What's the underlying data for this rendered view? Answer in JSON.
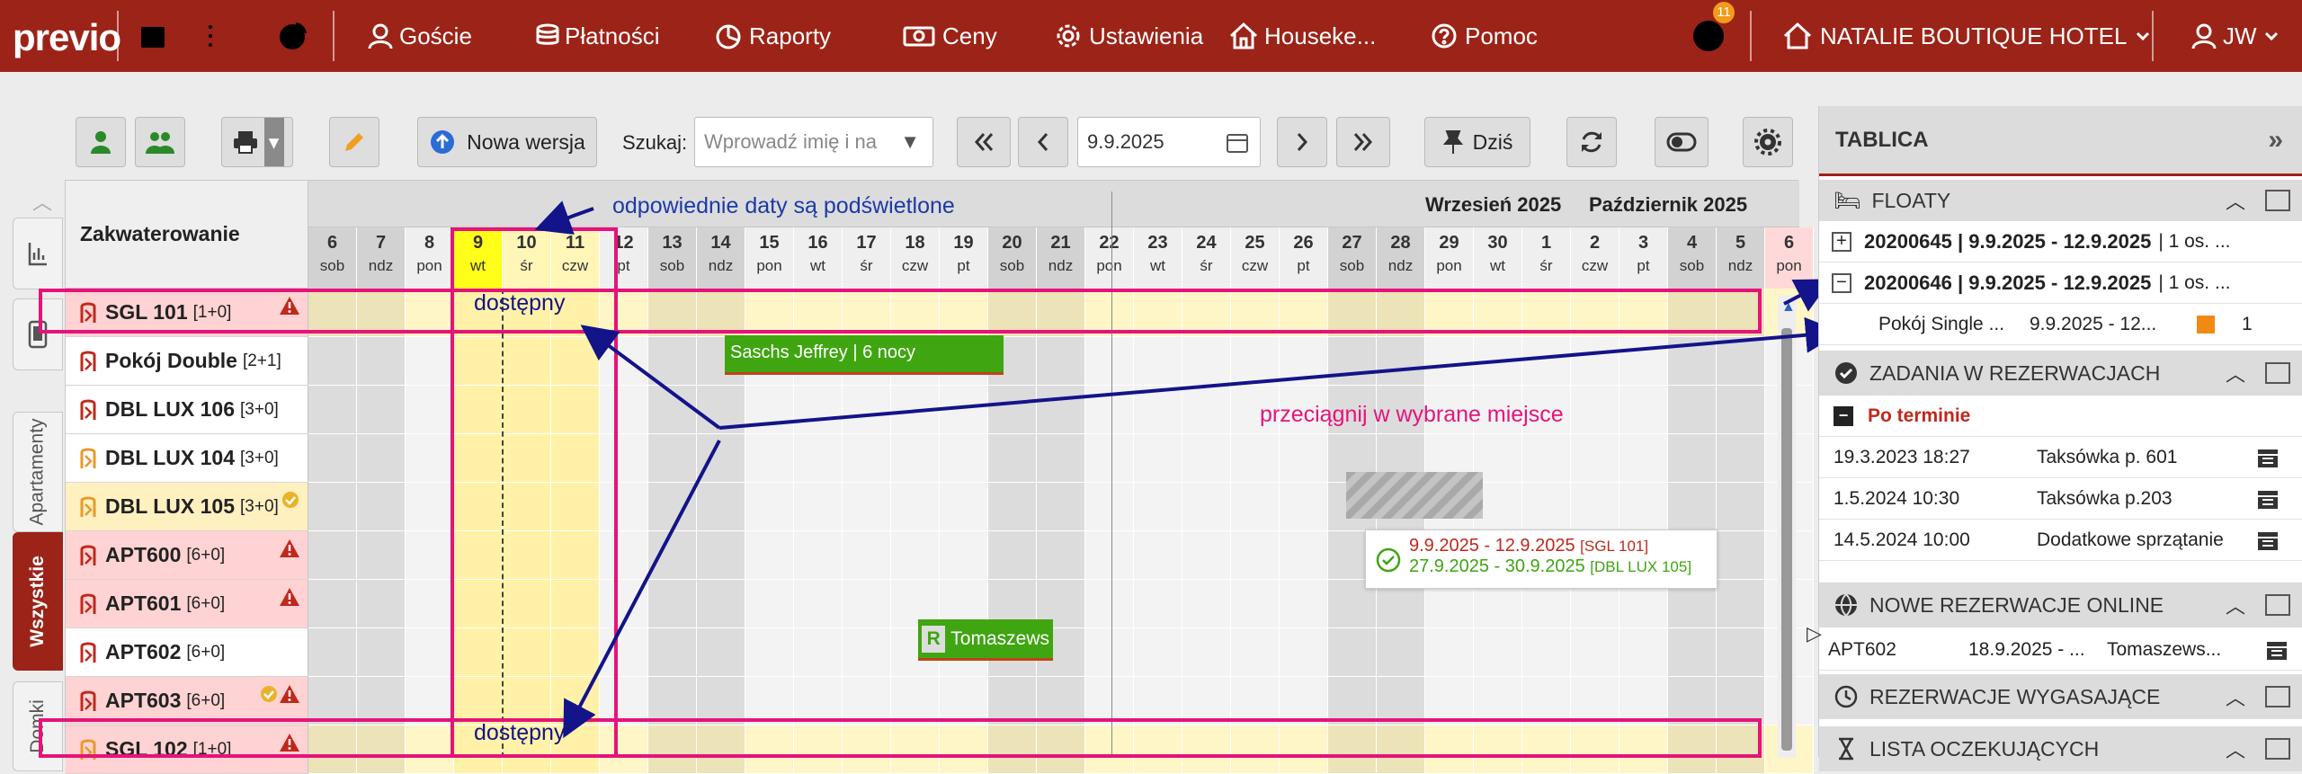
{
  "nav": {
    "logo": "previo",
    "guests": "Goście",
    "payments": "Płatności",
    "reports": "Raporty",
    "prices": "Ceny",
    "settings": "Ustawienia",
    "housekeeping": "Houseke...",
    "help": "Pomoc",
    "tasks_count": "11",
    "hotel": "NATALIE BOUTIQUE HOTEL",
    "user": "JW"
  },
  "toolbar": {
    "new_version": "Nowa wersja",
    "search_label": "Szukaj:",
    "search_placeholder": "Wprowadź imię i na",
    "date_value": "9.9.2025",
    "today": "Dziś"
  },
  "sidebar_tabs": [
    "Apartamenty",
    "Wszystkie",
    "Domki"
  ],
  "grid": {
    "header_label": "Zakwaterowanie",
    "month1": "Wrzesień 2025",
    "month2": "Październik 2025",
    "days": [
      {
        "n": "6",
        "w": "sob",
        "t": "we"
      },
      {
        "n": "7",
        "w": "ndz",
        "t": "we"
      },
      {
        "n": "8",
        "w": "pon",
        "t": ""
      },
      {
        "n": "9",
        "w": "wt",
        "t": "today"
      },
      {
        "n": "10",
        "w": "śr",
        "t": "sel"
      },
      {
        "n": "11",
        "w": "czw",
        "t": "sel"
      },
      {
        "n": "12",
        "w": "pt",
        "t": ""
      },
      {
        "n": "13",
        "w": "sob",
        "t": "we"
      },
      {
        "n": "14",
        "w": "ndz",
        "t": "we"
      },
      {
        "n": "15",
        "w": "pon",
        "t": ""
      },
      {
        "n": "16",
        "w": "wt",
        "t": ""
      },
      {
        "n": "17",
        "w": "śr",
        "t": ""
      },
      {
        "n": "18",
        "w": "czw",
        "t": ""
      },
      {
        "n": "19",
        "w": "pt",
        "t": ""
      },
      {
        "n": "20",
        "w": "sob",
        "t": "we"
      },
      {
        "n": "21",
        "w": "ndz",
        "t": "we"
      },
      {
        "n": "22",
        "w": "pon",
        "t": ""
      },
      {
        "n": "23",
        "w": "wt",
        "t": ""
      },
      {
        "n": "24",
        "w": "śr",
        "t": ""
      },
      {
        "n": "25",
        "w": "czw",
        "t": ""
      },
      {
        "n": "26",
        "w": "pt",
        "t": ""
      },
      {
        "n": "27",
        "w": "sob",
        "t": "we"
      },
      {
        "n": "28",
        "w": "ndz",
        "t": "we"
      },
      {
        "n": "29",
        "w": "pon",
        "t": ""
      },
      {
        "n": "30",
        "w": "wt",
        "t": ""
      },
      {
        "n": "1",
        "w": "śr",
        "t": ""
      },
      {
        "n": "2",
        "w": "czw",
        "t": ""
      },
      {
        "n": "3",
        "w": "pt",
        "t": ""
      },
      {
        "n": "4",
        "w": "sob",
        "t": "we"
      },
      {
        "n": "5",
        "w": "ndz",
        "t": "we"
      },
      {
        "n": "6",
        "w": "pon",
        "t": "hol"
      }
    ],
    "rooms": [
      {
        "name": "SGL 101",
        "cap": "[1+0]",
        "bg": "#ffd3d3",
        "icon": "#c0281c",
        "warn": true,
        "ok": false
      },
      {
        "name": "Pokój Double",
        "cap": "[2+1]",
        "bg": "#ffffff",
        "icon": "#c0281c",
        "warn": false,
        "ok": false
      },
      {
        "name": "DBL LUX 106",
        "cap": "[3+0]",
        "bg": "#ffffff",
        "icon": "#c0281c",
        "warn": false,
        "ok": false
      },
      {
        "name": "DBL LUX 104",
        "cap": "[3+0]",
        "bg": "#ffffff",
        "icon": "#e89a2a",
        "warn": false,
        "ok": false
      },
      {
        "name": "DBL LUX 105",
        "cap": "[3+0]",
        "bg": "#fff0c0",
        "icon": "#e89a2a",
        "warn": false,
        "ok": true
      },
      {
        "name": "APT600",
        "cap": "[6+0]",
        "bg": "#ffd3d3",
        "icon": "#c0281c",
        "warn": true,
        "ok": false
      },
      {
        "name": "APT601",
        "cap": "[6+0]",
        "bg": "#ffd3d3",
        "icon": "#c0281c",
        "warn": true,
        "ok": false
      },
      {
        "name": "APT602",
        "cap": "[6+0]",
        "bg": "#ffffff",
        "icon": "#c0281c",
        "warn": false,
        "ok": false
      },
      {
        "name": "APT603",
        "cap": "[6+0]",
        "bg": "#ffd3d3",
        "icon": "#c0281c",
        "warn": true,
        "ok": true
      },
      {
        "name": "SGL 102",
        "cap": "[1+0]",
        "bg": "#ffd3d3",
        "icon": "#e89a2a",
        "warn": true,
        "ok": false
      }
    ],
    "reservation1": "Saschs Jeffrey | 6 nocy",
    "reservation2": "Tomaszews",
    "tooltip_line1": "9.9.2025 - 12.9.2025",
    "tooltip_line1_room": "[SGL 101]",
    "tooltip_line2": "27.9.2025 - 30.9.2025",
    "tooltip_line2_room": "[DBL LUX 105]"
  },
  "annotations": {
    "dates_highlighted": "odpowiednie daty są podświetlone",
    "available": "dostępny",
    "drag_here": "przeciągnij w wybrane miejsce"
  },
  "panel": {
    "title": "TABLICA",
    "floaty": "FLOATY",
    "float1_id": "20200645 | 9.9.2025 - 12.9.2025",
    "float1_guests": "| 1 os. ...",
    "float2_id": "20200646 | 9.9.2025 - 12.9.2025",
    "float2_guests": "| 1 os. ...",
    "float_room": "Pokój Single ...",
    "float_dates": "9.9.2025 - 12...",
    "float_count": "1",
    "tasks_header": "ZADANIA W REZERWACJACH",
    "overdue": "Po terminie",
    "tasks": [
      {
        "date": "19.3.2023 18:27",
        "text": "Taksówka p. 601"
      },
      {
        "date": "1.5.2024 10:30",
        "text": "Taksówka p.203"
      },
      {
        "date": "14.5.2024 10:00",
        "text": "Dodatkowe sprzątanie"
      }
    ],
    "online_header": "NOWE REZERWACJE ONLINE",
    "online_room": "APT602",
    "online_dates": "18.9.2025 - ...",
    "online_guest": "Tomaszews...",
    "expiring_header": "REZERWACJE WYGASAJĄCE",
    "waiting_header": "LISTA OCZEKUJĄCYCH"
  },
  "colors": {
    "brand": "#9c2317",
    "highlight": "#e6137a",
    "annotation": "#13138a",
    "green": "#3fa511",
    "today": "#ffff1a"
  }
}
